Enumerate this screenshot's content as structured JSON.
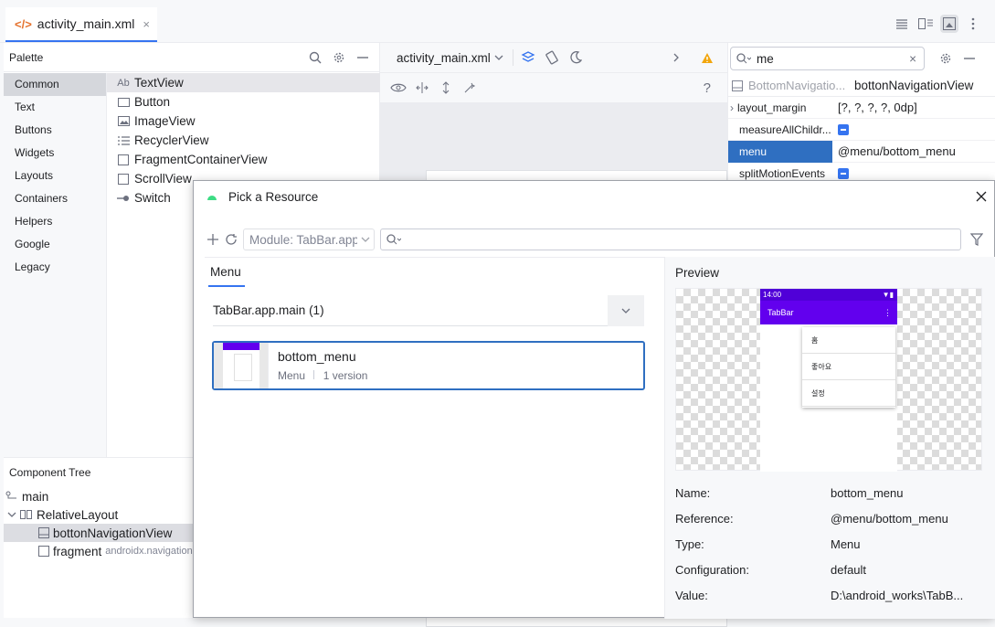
{
  "editor": {
    "tab_title": "activity_main.xml",
    "tab_close": "×"
  },
  "palette": {
    "title": "Palette",
    "categories": [
      "Common",
      "Text",
      "Buttons",
      "Widgets",
      "Layouts",
      "Containers",
      "Helpers",
      "Google",
      "Legacy"
    ],
    "selected_category": "Common",
    "items": [
      {
        "icon": "Ab",
        "label": "TextView"
      },
      {
        "icon": "button-icon",
        "label": "Button"
      },
      {
        "icon": "image-icon",
        "label": "ImageView"
      },
      {
        "icon": "list-icon",
        "label": "RecyclerView"
      },
      {
        "icon": "fragment-icon",
        "label": "FragmentContainerView"
      },
      {
        "icon": "scroll-icon",
        "label": "ScrollView"
      },
      {
        "icon": "switch-icon",
        "label": "Switch"
      }
    ]
  },
  "component_tree": {
    "title": "Component Tree",
    "nodes": [
      {
        "label": "main",
        "extra": ""
      },
      {
        "label": "RelativeLayout",
        "extra": ""
      },
      {
        "label": "bottonNavigationView",
        "extra": ""
      },
      {
        "label": "fragment",
        "extra": "androidx.navigation"
      }
    ]
  },
  "design_toolbar": {
    "file_dropdown": "activity_main.xml",
    "help": "?"
  },
  "attributes": {
    "search_value": "me",
    "header_type": "BottomNavigatio...",
    "header_id": "bottonNavigationView",
    "rows": [
      {
        "key": "layout_margin",
        "value": "[?, ?, ?, ?, 0dp]"
      },
      {
        "key": "measureAllChildr...",
        "value": ""
      },
      {
        "key": "menu",
        "value": "@menu/bottom_menu"
      },
      {
        "key": "splitMotionEvents",
        "value": ""
      }
    ]
  },
  "dialog": {
    "title": "Pick a Resource",
    "module_placeholder": "Module: TabBar.app",
    "tab_label": "Menu",
    "group_label": "TabBar.app.main (1)",
    "resource": {
      "name": "bottom_menu",
      "type": "Menu",
      "versions": "1 version"
    },
    "preview_label": "Preview",
    "preview": {
      "status_time": "14:00",
      "app_title": "TabBar",
      "menu_items": [
        "홈",
        "좋아요",
        "설정"
      ]
    },
    "details": [
      {
        "key": "Name:",
        "value": "bottom_menu"
      },
      {
        "key": "Reference:",
        "value": "@menu/bottom_menu"
      },
      {
        "key": "Type:",
        "value": "Menu"
      },
      {
        "key": "Configuration:",
        "value": "default"
      },
      {
        "key": "Value:",
        "value": "D:\\android_works\\TabB..."
      }
    ]
  },
  "colors": {
    "accent": "#3574f0",
    "selection": "#2f6fc1",
    "app_bar": "#6200ee",
    "warning": "#f2a60d"
  }
}
